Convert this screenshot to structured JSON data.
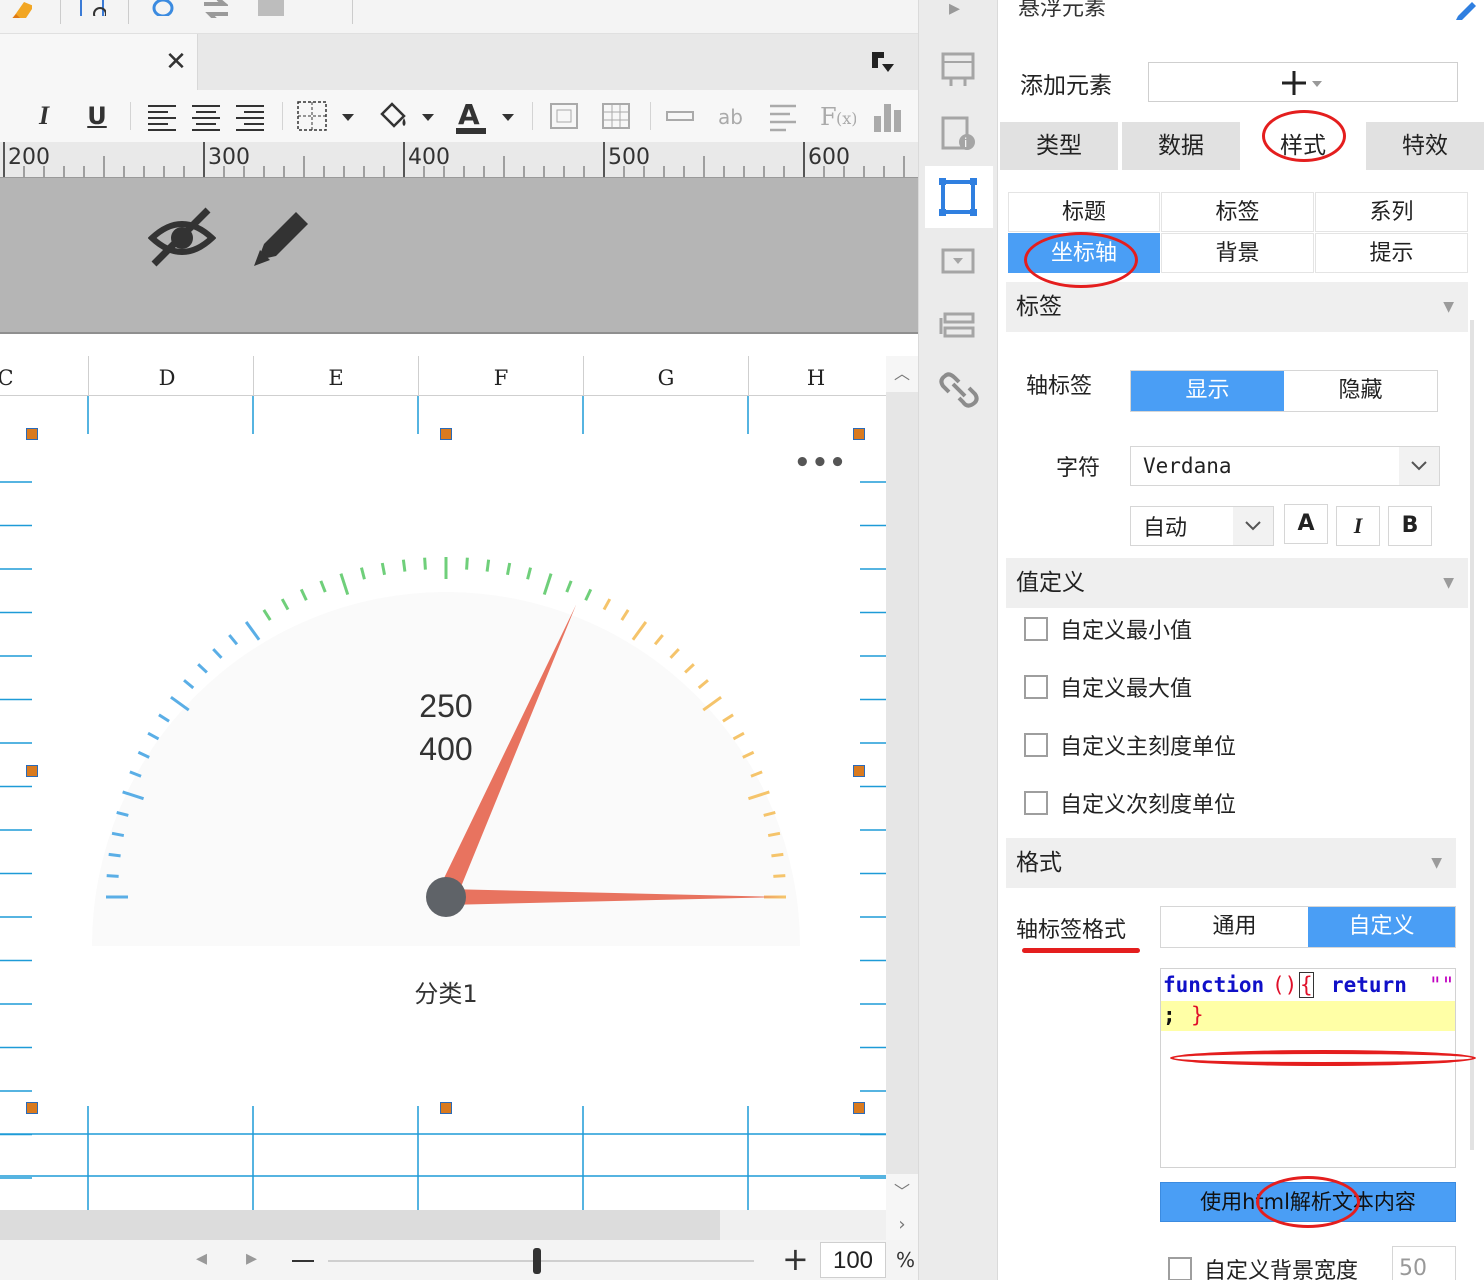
{
  "ruler": {
    "ticks": [
      "200",
      "300",
      "400",
      "500",
      "600"
    ]
  },
  "sheet": {
    "columns": [
      "C",
      "D",
      "E",
      "F",
      "G",
      "H"
    ],
    "gauge": {
      "value_label_1": "250",
      "value_label_2": "400",
      "category_label": "分类1"
    }
  },
  "zoom": {
    "value": "100",
    "unit": "%"
  },
  "panel": {
    "title": "悬浮元素",
    "add_label": "添加元素",
    "tabs": [
      "类型",
      "数据",
      "样式",
      "特效"
    ],
    "active_tab": "样式",
    "subtabs_row1": [
      "标题",
      "标签",
      "系列"
    ],
    "subtabs_row2": [
      "坐标轴",
      "背景",
      "提示"
    ],
    "active_subtab": "坐标轴",
    "section_label": "标签",
    "axis_label": {
      "label": "轴标签",
      "options": [
        "显示",
        "隐藏"
      ],
      "selected": "显示"
    },
    "font": {
      "label": "字符",
      "family": "Verdana",
      "size": "自动",
      "buttons": [
        "A",
        "I",
        "B"
      ]
    },
    "value_def": {
      "title": "值定义",
      "items": [
        "自定义最小值",
        "自定义最大值",
        "自定义主刻度单位",
        "自定义次刻度单位"
      ]
    },
    "format": {
      "title": "格式",
      "axis_label_format": "轴标签格式",
      "options": [
        "通用",
        "自定义"
      ],
      "selected": "自定义",
      "code_line1_keyword": "function",
      "code_line1_parens": "()",
      "code_line1_brace": "{",
      "code_line1_return": "return",
      "code_line1_string": "\"\"",
      "code_line2_semicolon": ";",
      "code_line2_brace": "}",
      "html_button": "使用html解析文本内容"
    },
    "bg_width": {
      "label": "自定义背景宽度",
      "value": "50"
    }
  },
  "colors": {
    "accent": "#4a9ef5",
    "annotation": "#e41e1e",
    "needle": "#e8735f",
    "hub": "#5f6368",
    "tick_blue": "#5aaee6",
    "tick_green": "#6fcf7a",
    "tick_yellow": "#f5c46b",
    "handle": "#d97a1f",
    "sheet_line": "#1e9bd7"
  }
}
